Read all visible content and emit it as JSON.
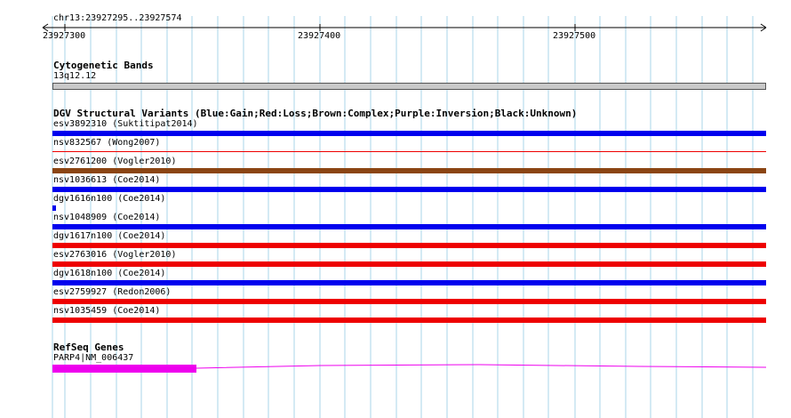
{
  "region": {
    "label": "chr13:23927295..23927574",
    "ticks": [
      "23927300",
      "23927400",
      "23927500"
    ]
  },
  "cytoband": {
    "title": "Cytogenetic Bands",
    "band": "13q12.12",
    "color": "#c8c8c8"
  },
  "dgv": {
    "title": "DGV Structural Variants (Blue:Gain;Red:Loss;Brown:Complex;Purple:Inversion;Black:Unknown)",
    "colors": {
      "gain": "#0000ee",
      "loss": "#ee0000",
      "complex": "#8b4513"
    },
    "variants": [
      {
        "label": "esv3892310 (Suktitipat2014)",
        "type": "gain"
      },
      {
        "label": "nsv832567 (Wong2007)",
        "type": "loss"
      },
      {
        "label": "esv2761200 (Vogler2010)",
        "type": "complex"
      },
      {
        "label": "nsv1036613 (Coe2014)",
        "type": "gain"
      },
      {
        "label": "dgv1616n100 (Coe2014)",
        "type": "gain"
      },
      {
        "label": "nsv1048909 (Coe2014)",
        "type": "gain"
      },
      {
        "label": "dgv1617n100 (Coe2014)",
        "type": "loss"
      },
      {
        "label": "esv2763016 (Vogler2010)",
        "type": "loss"
      },
      {
        "label": "dgv1618n100 (Coe2014)",
        "type": "gain"
      },
      {
        "label": "esv2759927 (Redon2006)",
        "type": "loss"
      },
      {
        "label": "nsv1035459 (Coe2014)",
        "type": "loss"
      }
    ]
  },
  "refseq": {
    "title": "RefSeq Genes",
    "gene": "PARP4|NM_006437",
    "color": "#ee00ee"
  }
}
